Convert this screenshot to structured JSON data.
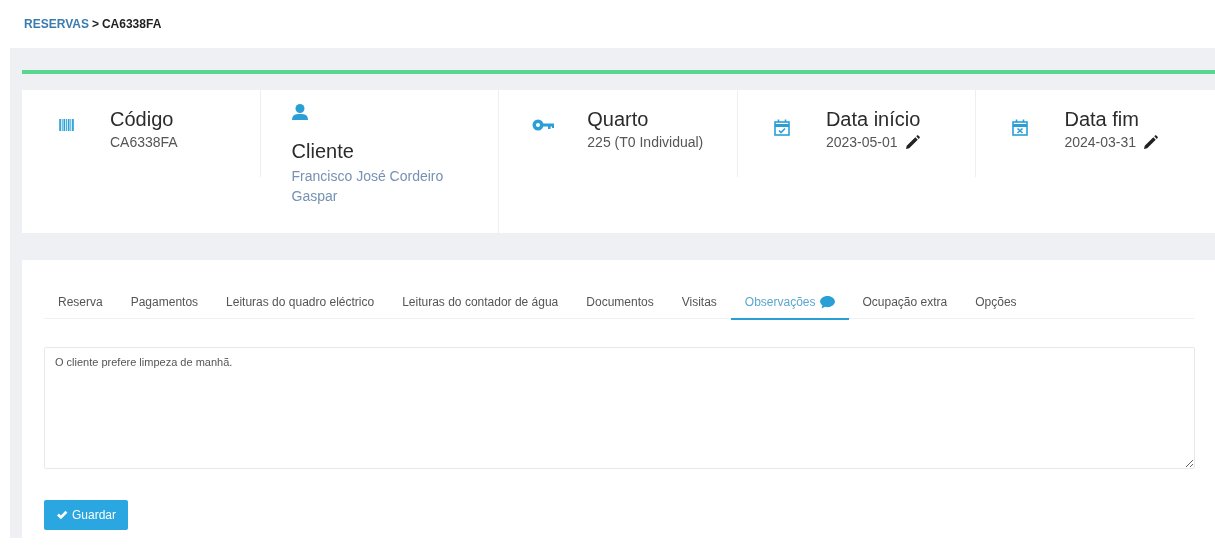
{
  "breadcrumb": {
    "parent": "RESERVAS",
    "separator": ">",
    "current": "CA6338FA"
  },
  "summary": [
    {
      "kind": "barcode",
      "title": "Código",
      "value": "CA6338FA",
      "link": false,
      "editable": false
    },
    {
      "kind": "person",
      "title": "Cliente",
      "value": "Francisco José Cordeiro Gaspar",
      "link": true,
      "editable": false
    },
    {
      "kind": "key",
      "title": "Quarto",
      "value": "225 (T0 Individual)",
      "link": false,
      "editable": false
    },
    {
      "kind": "calendar-check",
      "title": "Data início",
      "value": "2023-05-01",
      "link": false,
      "editable": true
    },
    {
      "kind": "calendar-x",
      "title": "Data fim",
      "value": "2024-03-31",
      "link": false,
      "editable": true
    }
  ],
  "tabs": [
    {
      "label": "Reserva",
      "selected": false,
      "comment": false
    },
    {
      "label": "Pagamentos",
      "selected": false,
      "comment": false
    },
    {
      "label": "Leituras do quadro eléctrico",
      "selected": false,
      "comment": false
    },
    {
      "label": "Leituras do contador de água",
      "selected": false,
      "comment": false
    },
    {
      "label": "Documentos",
      "selected": false,
      "comment": false
    },
    {
      "label": "Visitas",
      "selected": false,
      "comment": false
    },
    {
      "label": "Observações",
      "selected": true,
      "comment": true
    },
    {
      "label": "Ocupação extra",
      "selected": false,
      "comment": false
    },
    {
      "label": "Opções",
      "selected": false,
      "comment": false
    }
  ],
  "notes": {
    "value": "O cliente prefere limpeza de manhã."
  },
  "save_button": {
    "label": "Guardar"
  }
}
